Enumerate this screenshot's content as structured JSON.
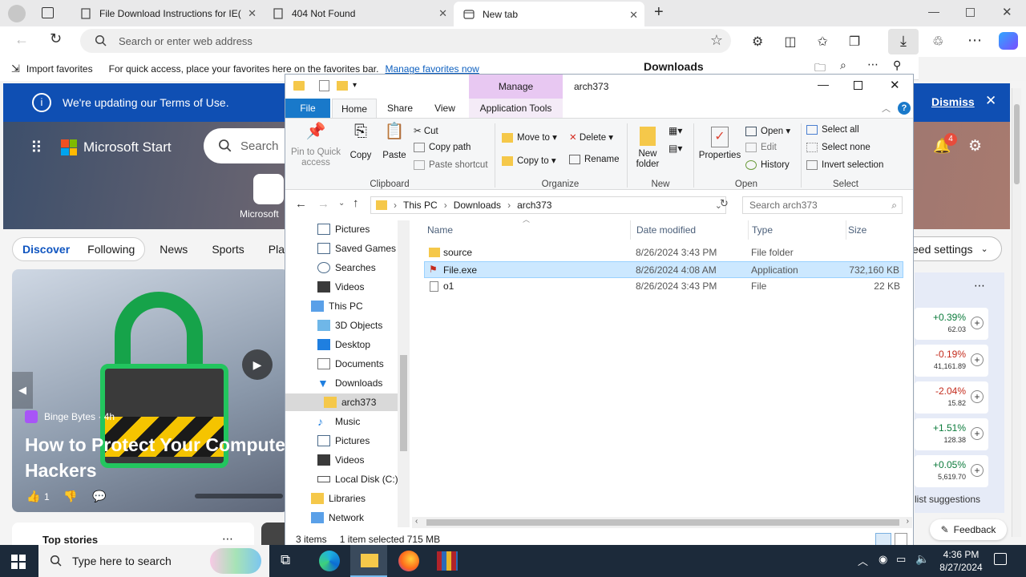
{
  "browser": {
    "tabs": [
      {
        "label": "File Download Instructions for IE(",
        "icon": "document-icon"
      },
      {
        "label": "404 Not Found",
        "icon": "document-icon"
      },
      {
        "label": "New tab",
        "icon": "newtab-icon"
      }
    ],
    "address_placeholder": "Search or enter web address",
    "favorites": {
      "import": "Import favorites",
      "hint": "For quick access, place your favorites here on the favorites bar.",
      "manage_link": "Manage favorites now"
    },
    "downloads_title": "Downloads"
  },
  "page": {
    "terms_banner": "We're updating our Terms of Use.",
    "dismiss": "Dismiss",
    "brand": "Microsoft Start",
    "search_placeholder": "Search",
    "copilot_label": "Microsoft",
    "notification_count": "4",
    "nav": [
      "Discover",
      "Following",
      "News",
      "Sports",
      "Play"
    ],
    "feed_settings": "eed settings",
    "story": {
      "source": "Binge Bytes · 4h",
      "title": "How to Protect Your Compute Hackers",
      "likes": "1"
    },
    "top_stories": "Top stories",
    "stocks": [
      {
        "pct": "+0.39%",
        "val": "62.03",
        "color": "#0a7a3a"
      },
      {
        "pct": "-0.19%",
        "val": "41,161.89",
        "color": "#c42b1c"
      },
      {
        "pct": "-2.04%",
        "val": "15.82",
        "color": "#c42b1c"
      },
      {
        "pct": "+1.51%",
        "val": "128.38",
        "color": "#0a7a3a"
      },
      {
        "pct": "+0.05%",
        "val": "5,619.70",
        "color": "#0a7a3a"
      }
    ],
    "list_suggestions": "list suggestions",
    "feedback": "Feedback"
  },
  "explorer": {
    "title": "arch373",
    "manage": "Manage",
    "tabs": [
      "File",
      "Home",
      "Share",
      "View",
      "Application Tools"
    ],
    "clipboard": {
      "pin": "Pin to Quick access",
      "copy": "Copy",
      "paste": "Paste",
      "cut": "Cut",
      "copy_path": "Copy path",
      "paste_shortcut": "Paste shortcut",
      "group": "Clipboard"
    },
    "organize": {
      "move_to": "Move to",
      "copy_to": "Copy to",
      "delete": "Delete",
      "rename": "Rename",
      "group": "Organize"
    },
    "new": {
      "new_folder": "New folder",
      "group": "New"
    },
    "open": {
      "properties": "Properties",
      "open": "Open",
      "edit": "Edit",
      "history": "History",
      "group": "Open"
    },
    "select": {
      "select_all": "Select all",
      "select_none": "Select none",
      "invert": "Invert selection",
      "group": "Select"
    },
    "breadcrumb": [
      "This PC",
      "Downloads",
      "arch373"
    ],
    "search_placeholder": "Search arch373",
    "nav_items": [
      {
        "label": "Pictures"
      },
      {
        "label": "Saved Games"
      },
      {
        "label": "Searches"
      },
      {
        "label": "Videos"
      },
      {
        "label": "This PC"
      },
      {
        "label": "3D Objects"
      },
      {
        "label": "Desktop"
      },
      {
        "label": "Documents"
      },
      {
        "label": "Downloads"
      },
      {
        "label": "arch373"
      },
      {
        "label": "Music"
      },
      {
        "label": "Pictures"
      },
      {
        "label": "Videos"
      },
      {
        "label": "Local Disk (C:)"
      },
      {
        "label": "Libraries"
      },
      {
        "label": "Network"
      }
    ],
    "columns": [
      "Name",
      "Date modified",
      "Type",
      "Size"
    ],
    "files": [
      {
        "name": "source",
        "date": "8/26/2024 3:43 PM",
        "type": "File folder",
        "size": ""
      },
      {
        "name": "File.exe",
        "date": "8/26/2024 4:08 AM",
        "type": "Application",
        "size": "732,160 KB"
      },
      {
        "name": "o1",
        "date": "8/26/2024 3:43 PM",
        "type": "File",
        "size": "22 KB"
      }
    ],
    "status": {
      "items": "3 items",
      "selected": "1 item selected  715 MB"
    }
  },
  "taskbar": {
    "search_placeholder": "Type here to search",
    "time": "4:36 PM",
    "date": "8/27/2024"
  }
}
